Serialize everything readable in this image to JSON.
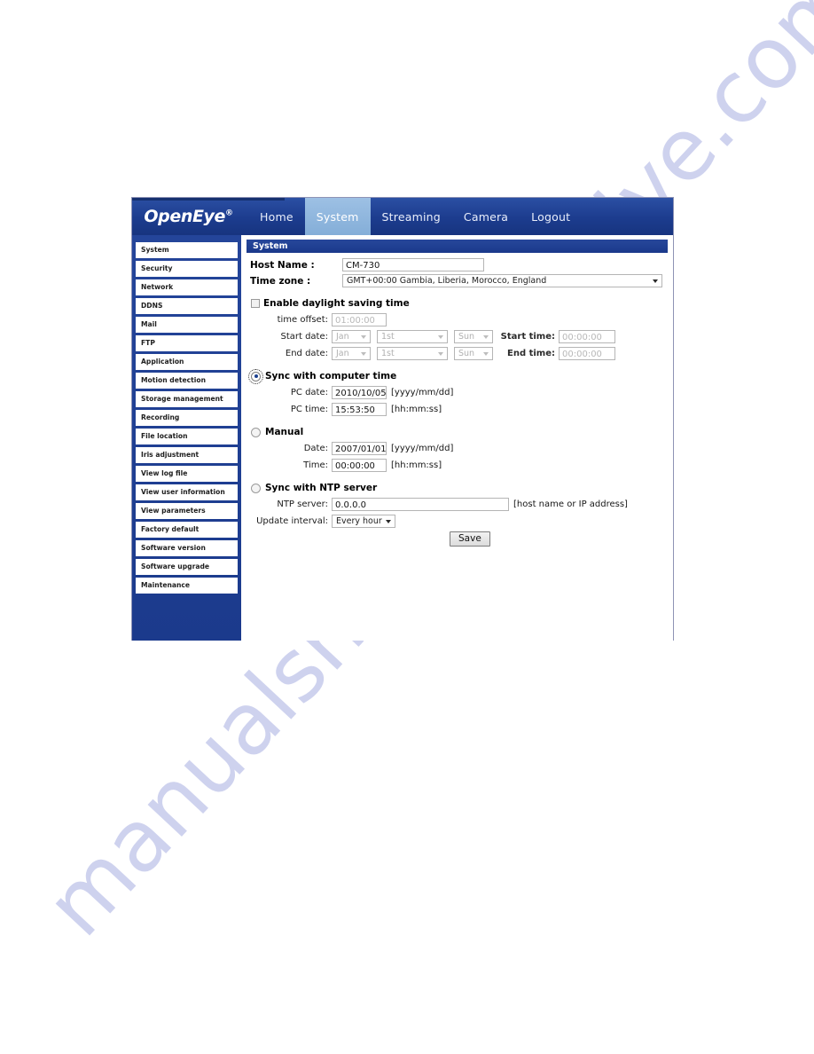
{
  "watermark": {
    "line1": "manualshive.com",
    "line2": "manualshive.com"
  },
  "brand": {
    "name": "OpenEye",
    "trademark": "®"
  },
  "nav": {
    "items": [
      {
        "label": "Home",
        "active": false
      },
      {
        "label": "System",
        "active": true
      },
      {
        "label": "Streaming",
        "active": false
      },
      {
        "label": "Camera",
        "active": false
      },
      {
        "label": "Logout",
        "active": false
      }
    ]
  },
  "sidebar": {
    "items": [
      {
        "label": "System"
      },
      {
        "label": "Security"
      },
      {
        "label": "Network"
      },
      {
        "label": "DDNS"
      },
      {
        "label": "Mail"
      },
      {
        "label": "FTP"
      },
      {
        "label": "Application"
      },
      {
        "label": "Motion detection"
      },
      {
        "label": "Storage management"
      },
      {
        "label": "Recording"
      },
      {
        "label": "File location"
      },
      {
        "label": "Iris adjustment"
      },
      {
        "label": "View log file"
      },
      {
        "label": "View user information"
      },
      {
        "label": "View parameters"
      },
      {
        "label": "Factory default"
      },
      {
        "label": "Software version"
      },
      {
        "label": "Software upgrade"
      },
      {
        "label": "Maintenance"
      }
    ]
  },
  "panel": {
    "title": "System",
    "host_name_label": "Host Name :",
    "host_name_value": "CM-730",
    "time_zone_label": "Time zone :",
    "time_zone_value": "GMT+00:00 Gambia, Liberia, Morocco, England"
  },
  "dst": {
    "checkbox_label": "Enable daylight saving time",
    "checked": false,
    "time_offset_label": "time offset:",
    "time_offset_value": "01:00:00",
    "start_date_label": "Start date:",
    "start_month": "Jan",
    "start_week": "1st",
    "start_day": "Sun",
    "start_time_label": "Start time:",
    "start_time_value": "00:00:00",
    "end_date_label": "End date:",
    "end_month": "Jan",
    "end_week": "1st",
    "end_day": "Sun",
    "end_time_label": "End time:",
    "end_time_value": "00:00:00"
  },
  "sync_pc": {
    "radio_label": "Sync with computer time",
    "selected": true,
    "pc_date_label": "PC date:",
    "pc_date_value": "2010/10/05",
    "pc_date_hint": "[yyyy/mm/dd]",
    "pc_time_label": "PC time:",
    "pc_time_value": "15:53:50",
    "pc_time_hint": "[hh:mm:ss]"
  },
  "manual": {
    "radio_label": "Manual",
    "selected": false,
    "date_label": "Date:",
    "date_value": "2007/01/01",
    "date_hint": "[yyyy/mm/dd]",
    "time_label": "Time:",
    "time_value": "00:00:00",
    "time_hint": "[hh:mm:ss]"
  },
  "ntp": {
    "radio_label": "Sync with NTP server",
    "selected": false,
    "server_label": "NTP server:",
    "server_value": "0.0.0.0",
    "server_hint": "[host name or IP address]",
    "interval_label": "Update interval:",
    "interval_value": "Every hour"
  },
  "actions": {
    "save_label": "Save"
  },
  "colors": {
    "brand_blue": "#1e3f92",
    "active_tab": "#8fb5dd",
    "panel_header": "#1e3f92",
    "watermark": "#ccd0ee"
  }
}
